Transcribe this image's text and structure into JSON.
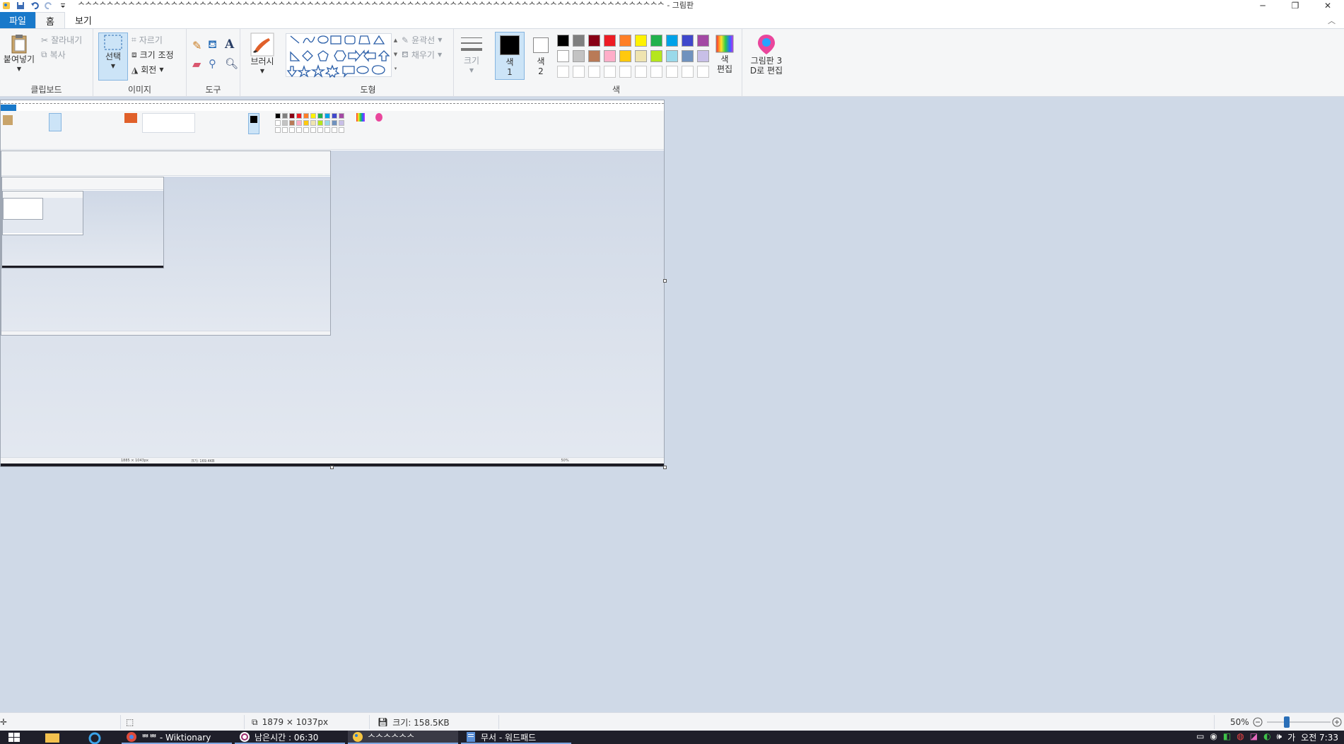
{
  "window": {
    "title": "ᄉᄉᄉᄉᄉᄉᄉᄉᄉᄉᄉᄉᄉᄉᄉᄉᄉᄉᄉᄉᄉᄉᄉᄉᄉᄉᄉᄉᄉᄉᄉᄉᄉᄉᄉᄉᄉᄉᄉᄉᄉᄉᄉᄉᄉᄉᄉᄉᄉᄉᄉᄉᄉᄉᄉᄉᄉᄉᄉᄉᄉᄉᄉᄉᄉᄉᄉᄉᄉᄉᄉᄉᄉᄉᄉᄉᄉᄉᄉᄉᄉᄉ - 그림판",
    "minimize": "─",
    "restore": "❐",
    "close": "✕"
  },
  "tabs": {
    "file": "파일",
    "home": "홈",
    "view": "보기"
  },
  "ribbon": {
    "clipboard": {
      "label": "클립보드",
      "paste": "붙여넣기",
      "cut": "잘라내기",
      "copy": "복사"
    },
    "image": {
      "label": "이미지",
      "select": "선택",
      "crop": "자르기",
      "resize": "크기 조정",
      "rotate": "회전"
    },
    "tools": {
      "label": "도구"
    },
    "brushes": {
      "label": "브러시"
    },
    "shapes": {
      "label": "도형",
      "outline": "윤곽선",
      "fill": "채우기"
    },
    "size": {
      "label": "크기"
    },
    "colors": {
      "label": "색",
      "color1": "색\n1",
      "color2": "색\n2",
      "color1_line1": "색",
      "color1_line2": "1",
      "color2_line1": "색",
      "color2_line2": "2",
      "edit_line1": "색",
      "edit_line2": "편집",
      "palette_row1": [
        "#000000",
        "#7f7f7f",
        "#880015",
        "#ed1c24",
        "#ff7f27",
        "#fff200",
        "#22b14c",
        "#00a2e8",
        "#3f48cc",
        "#a349a4"
      ],
      "palette_row2": [
        "#ffffff",
        "#c3c3c3",
        "#b97a57",
        "#ffaec9",
        "#ffc90e",
        "#efe4b0",
        "#b5e61d",
        "#99d9ea",
        "#7092be",
        "#c8bfe7"
      ]
    },
    "paint3d": {
      "line1": "그림판 3",
      "line2": "D로 편집"
    }
  },
  "statusbar": {
    "dimensions": "1879 × 1037px",
    "size": "크기: 158.5KB",
    "zoom": "50%"
  },
  "taskbar": {
    "apps": [
      {
        "label": "ᄈᄈ - Wiktionary"
      },
      {
        "label": "남은시간 : 06:30"
      },
      {
        "label": "ᄉᄉᄉᄉᄉᄉ"
      },
      {
        "label": "무서 - 워드패드"
      }
    ],
    "tray_ime": "가",
    "clock": "오전 7:33"
  },
  "mini": {
    "dimensions": "1885 × 1043px",
    "size": "크기: 169.4KB",
    "zoom": "50%"
  }
}
